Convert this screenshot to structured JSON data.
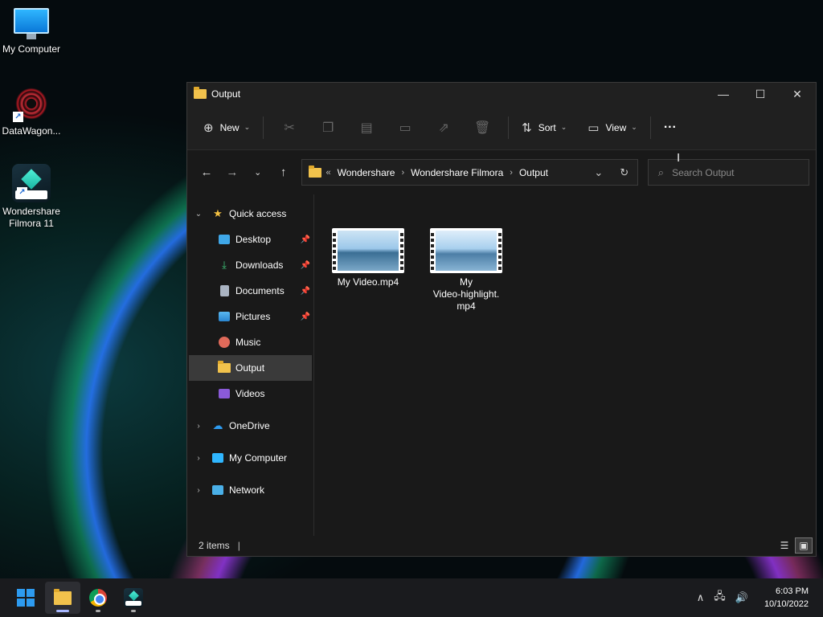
{
  "desktop": {
    "icons": [
      {
        "label": "My Computer"
      },
      {
        "label": "DataWagon..."
      },
      {
        "label": "Wondershare Filmora 11"
      }
    ]
  },
  "window": {
    "title": "Output",
    "controls": {
      "minimize": "—",
      "maximize": "☐",
      "close": "✕"
    },
    "toolbar": {
      "new_label": "New",
      "sort_label": "Sort",
      "view_label": "View",
      "more_label": "···"
    },
    "address": {
      "overflow": "«",
      "crumbs": [
        "Wondershare",
        "Wondershare Filmora",
        "Output"
      ]
    },
    "search": {
      "placeholder": "Search Output"
    },
    "nav": {
      "quick_access": "Quick access",
      "items": [
        "Desktop",
        "Downloads",
        "Documents",
        "Pictures",
        "Music",
        "Output",
        "Videos"
      ],
      "onedrive": "OneDrive",
      "my_computer": "My Computer",
      "network": "Network"
    },
    "files": [
      {
        "name": "My Video.mp4"
      },
      {
        "name_line1": "My",
        "name_line2": "Video-highlight.",
        "name_line3": "mp4"
      }
    ],
    "status": {
      "items": "2 items"
    }
  },
  "taskbar": {
    "time": "6:03 PM",
    "date": "10/10/2022"
  },
  "colors": {
    "accent": "#2d9bf0",
    "folder": "#f1c24c",
    "selected_bg": "#3a3a3a"
  }
}
